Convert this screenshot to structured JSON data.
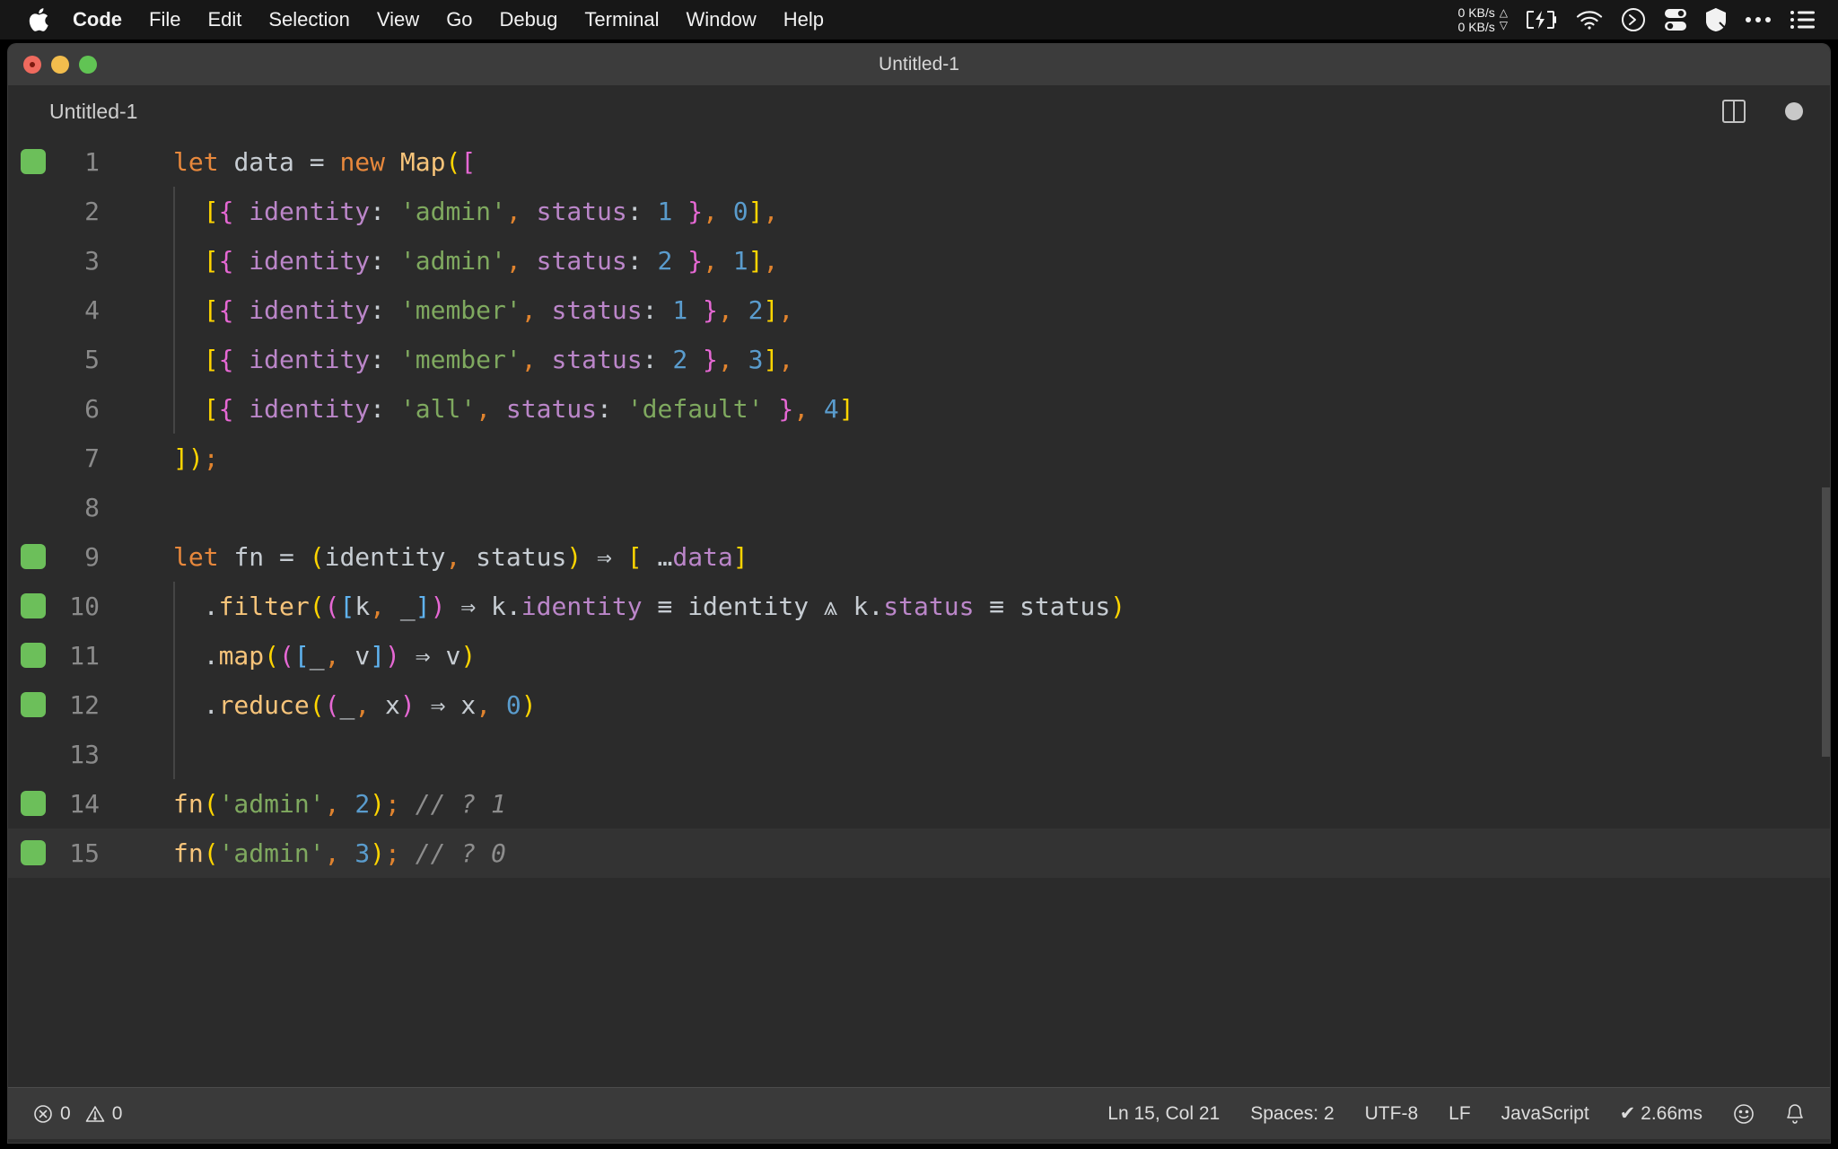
{
  "menubar": {
    "apple_icon": "apple-logo-icon",
    "items": [
      {
        "label": "Code",
        "bold": true
      },
      {
        "label": "File",
        "bold": false
      },
      {
        "label": "Edit",
        "bold": false
      },
      {
        "label": "Selection",
        "bold": false
      },
      {
        "label": "View",
        "bold": false
      },
      {
        "label": "Go",
        "bold": false
      },
      {
        "label": "Debug",
        "bold": false
      },
      {
        "label": "Terminal",
        "bold": false
      },
      {
        "label": "Window",
        "bold": false
      },
      {
        "label": "Help",
        "bold": false
      }
    ],
    "tray": {
      "net_up": "0 KB/s",
      "net_down": "0 KB/s",
      "up_arrow": "△",
      "down_arrow": "▽",
      "icons": [
        "battery-charging-icon",
        "wifi-icon",
        "terminal-circle-icon",
        "toggles-icon",
        "shield-icon",
        "ellipsis-icon",
        "control-center-list-icon"
      ]
    }
  },
  "window": {
    "title": "Untitled-1",
    "traffic_lights": [
      "close-button",
      "minimize-button",
      "zoom-button"
    ]
  },
  "tab": {
    "label": "Untitled-1",
    "split_label": "split-editor-icon",
    "dirty_label": "unsaved-changes-dot"
  },
  "editor": {
    "lines": [
      {
        "n": "1",
        "mark": true,
        "indent": false,
        "active": false
      },
      {
        "n": "2",
        "mark": false,
        "indent": true,
        "active": false
      },
      {
        "n": "3",
        "mark": false,
        "indent": true,
        "active": false
      },
      {
        "n": "4",
        "mark": false,
        "indent": true,
        "active": false
      },
      {
        "n": "5",
        "mark": false,
        "indent": true,
        "active": false
      },
      {
        "n": "6",
        "mark": false,
        "indent": true,
        "active": false
      },
      {
        "n": "7",
        "mark": false,
        "indent": false,
        "active": false
      },
      {
        "n": "8",
        "mark": false,
        "indent": false,
        "active": false
      },
      {
        "n": "9",
        "mark": true,
        "indent": false,
        "active": false
      },
      {
        "n": "10",
        "mark": true,
        "indent": true,
        "active": false
      },
      {
        "n": "11",
        "mark": true,
        "indent": true,
        "active": false
      },
      {
        "n": "12",
        "mark": true,
        "indent": true,
        "active": false
      },
      {
        "n": "13",
        "mark": false,
        "indent": true,
        "active": false
      },
      {
        "n": "14",
        "mark": true,
        "indent": false,
        "active": false
      },
      {
        "n": "15",
        "mark": true,
        "indent": false,
        "active": true
      }
    ],
    "language": "JavaScript",
    "source_text": "let data = new Map([\n  [{ identity: 'admin', status: 1 }, 0],\n  [{ identity: 'admin', status: 2 }, 1],\n  [{ identity: 'member', status: 1 }, 2],\n  [{ identity: 'member', status: 2 }, 3],\n  [{ identity: 'all', status: 'default' }, 4]\n]);\n\nlet fn = (identity, status) => [ ...data]\n  .filter(([k, _]) => k.identity === identity && k.status === status)\n  .map(([_, v]) => v)\n  .reduce((_, x) => x, 0)\n\nfn('admin', 2); // ? 1\nfn('admin', 3); // ? 0"
  },
  "statusbar": {
    "errors": "0",
    "warnings": "0",
    "error_icon": "error-circle-icon",
    "warning_icon": "warning-triangle-icon",
    "position": "Ln 15, Col 21",
    "indentation": "Spaces: 2",
    "encoding": "UTF-8",
    "eol": "LF",
    "language": "JavaScript",
    "runtime": "✔ 2.66ms",
    "feedback_icon": "smiley-icon",
    "notifications_icon": "bell-icon"
  },
  "colors": {
    "editor_background": "#2b2b2b",
    "active_line": "#333333",
    "titlebar": "#3c3c3c",
    "statusbar": "#3a3a3a",
    "gutter_mark_green": "#6cbf5a",
    "keyword_orange": "#e8883c",
    "string_green": "#7fa95f",
    "number_blue": "#5a9ccd",
    "property_purple": "#bb86c9",
    "function_yellow": "#f7c47a",
    "comment_gray": "#8d8d8d",
    "bracket_yellow": "#ffd500",
    "bracket_magenta": "#e668d4",
    "bracket_blue": "#5fb3f0",
    "comma_orange": "#e0832e"
  }
}
